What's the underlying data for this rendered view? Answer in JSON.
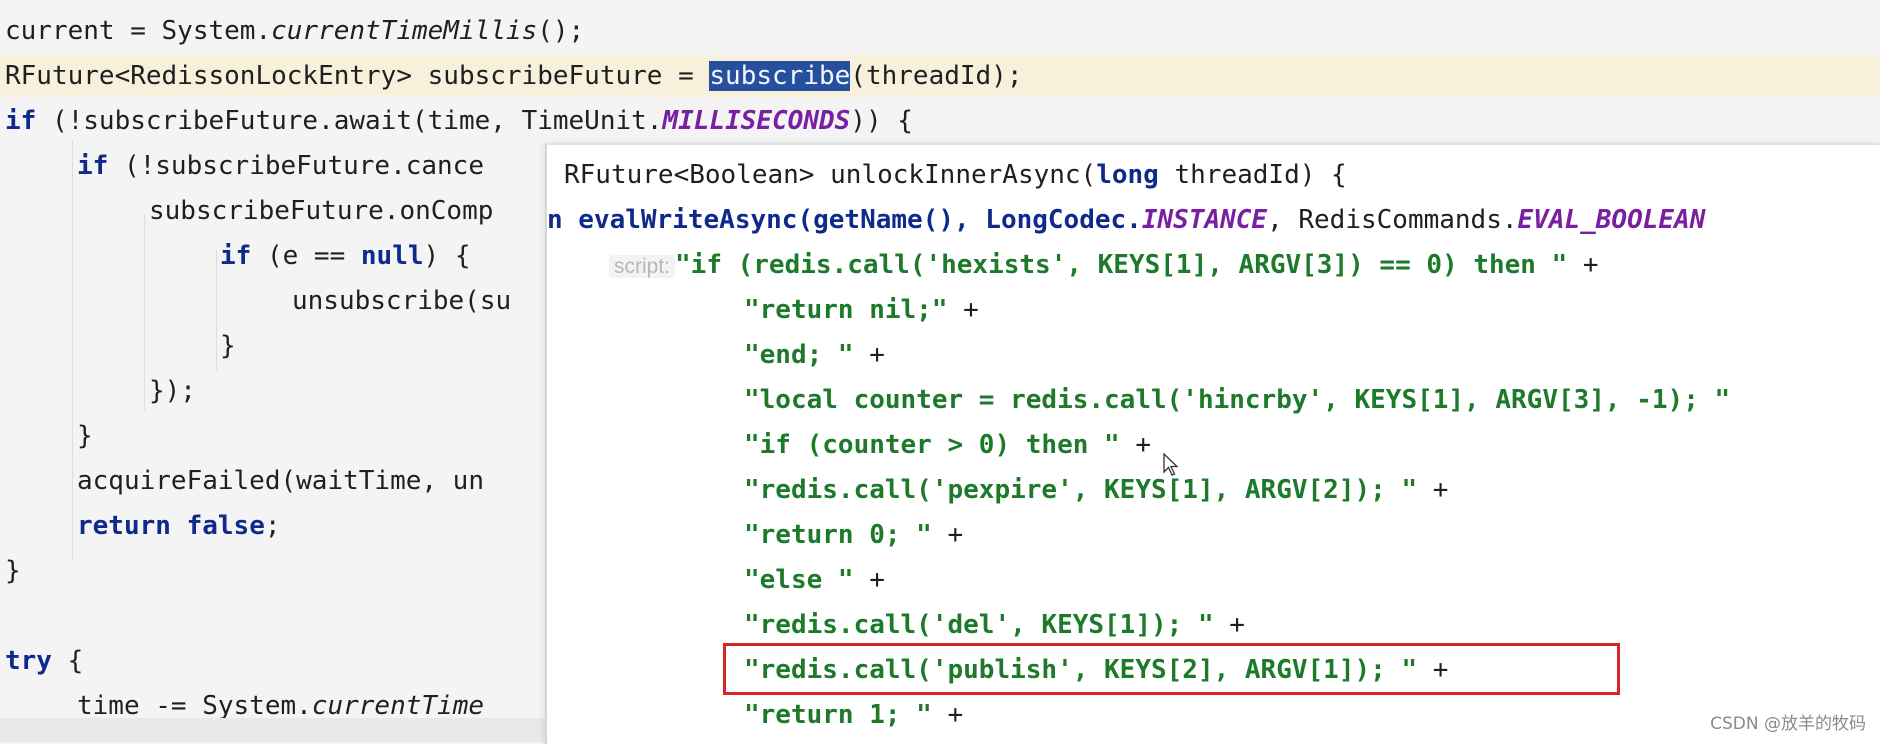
{
  "editor": {
    "lines": [
      {
        "a": "current = System.",
        "b": "currentTimeMillis",
        "c": "();"
      },
      {
        "a": "RFuture<RedissonLockEntry> subscribeFuture = ",
        "b": "subscribe",
        "c": "(threadId);"
      },
      {
        "a": "if",
        "b": " (!subscribeFuture.await(time, TimeUnit.",
        "c": "MILLISECONDS",
        "d": ")) {"
      },
      {
        "a": "if",
        "b": " (!subscribeFuture.cance"
      },
      {
        "a": "subscribeFuture.onComp"
      },
      {
        "a": "if",
        "b": " (e == ",
        "c": "null",
        "d": ") {"
      },
      {
        "a": "unsubscribe(su"
      },
      {
        "a": "}"
      },
      {
        "a": "});"
      },
      {
        "a": "}"
      },
      {
        "a": "acquireFailed(waitTime, un"
      },
      {
        "a": "return",
        "b": " ",
        "c": "false",
        "d": ";"
      },
      {
        "a": "}"
      },
      {
        "a": "try",
        "b": " {"
      },
      {
        "a": "time -= System.",
        "b": "currentTime"
      }
    ]
  },
  "popup": {
    "signature": {
      "a": "RFuture<Boolean> unlockInnerAsync(",
      "b": "long",
      "c": " threadId) {"
    },
    "call": {
      "a": "n evalWriteAsync(getName(), LongCodec.",
      "b": "INSTANCE",
      "c": ", RedisCommands.",
      "d": "EVAL_BOOLEAN"
    },
    "script_hint": "script:",
    "script_lines": [
      {
        "s": "\"if (redis.call('hexists', KEYS[1], ARGV[3]) == 0) then \"",
        "t": " +"
      },
      {
        "s": "\"return nil;\"",
        "t": " +"
      },
      {
        "s": "\"end; \"",
        "t": " +"
      },
      {
        "s": "\"local counter = redis.call('hincrby', KEYS[1], ARGV[3], -1); \"",
        "t": ""
      },
      {
        "s": "\"if (counter > 0) then \"",
        "t": " +"
      },
      {
        "s": "\"redis.call('pexpire', KEYS[1], ARGV[2]); \"",
        "t": " +"
      },
      {
        "s": "\"return 0; \"",
        "t": " +"
      },
      {
        "s": "\"else \"",
        "t": " +"
      },
      {
        "s": "\"redis.call('del', KEYS[1]); \"",
        "t": " +"
      },
      {
        "s": "\"redis.call('publish', KEYS[2], ARGV[1]); \"",
        "t": " +"
      },
      {
        "s": "\"return 1; \"",
        "t": " +"
      }
    ]
  },
  "watermark": "CSDN @放羊的牧码",
  "icons": {
    "cursor": "mouse-pointer-icon"
  },
  "colors": {
    "keyword": "#0f2a8a",
    "string": "#1c7a2a",
    "constant": "#7a1fa2",
    "selection": "#26509e",
    "highlight_box": "#d7262b"
  }
}
